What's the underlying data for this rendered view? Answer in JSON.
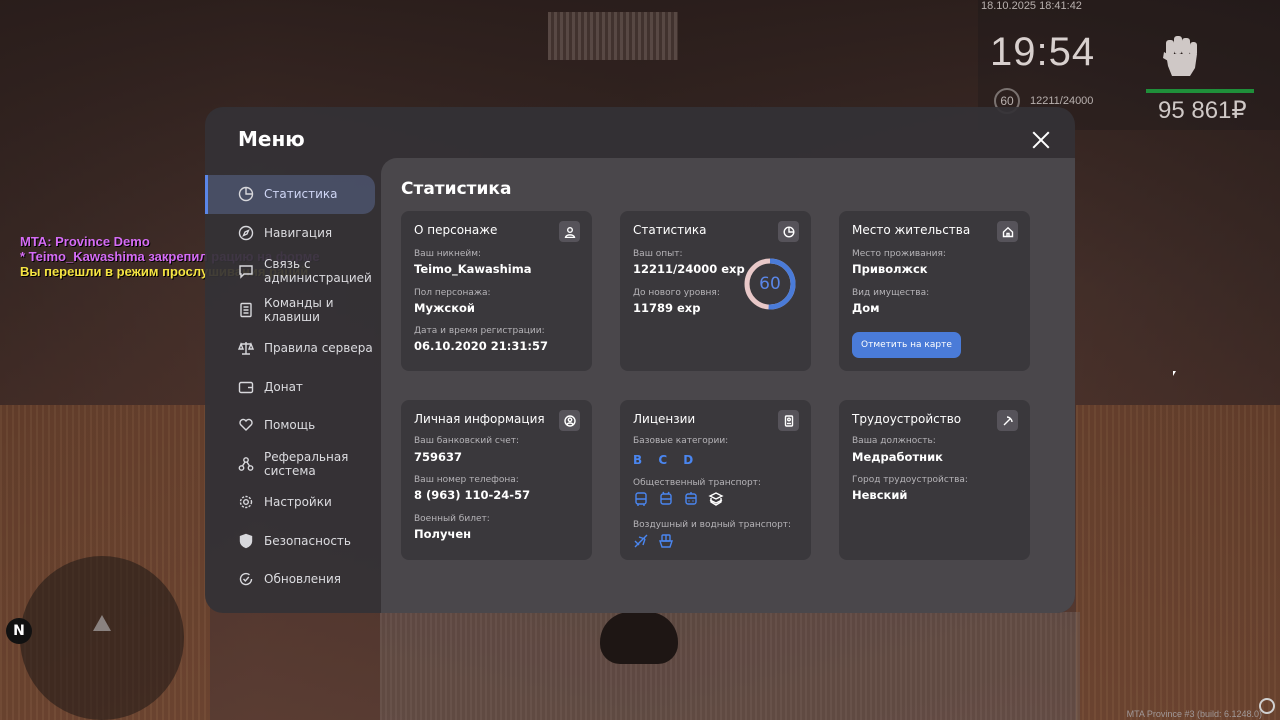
{
  "hud": {
    "datetime": "18.10.2025 18:41:42",
    "time": "19:54",
    "level": "60",
    "exp": "12211/24000",
    "money": "95 861₽",
    "health_fraction": 1.0,
    "build": "MTA Province #3 (build: 6.1248.0)"
  },
  "chat": {
    "line1": "MTA: Province Demo",
    "line2": "* Teimo_Kawashima закрепил рацию на форме",
    "line3": "Вы перешли в режим прослушивания раций."
  },
  "minimap": {
    "compass": "N"
  },
  "menu": {
    "title": "Меню",
    "sidebar": [
      {
        "label": "Статистика",
        "icon": "chart-pie-icon"
      },
      {
        "label": "Навигация",
        "icon": "compass-icon"
      },
      {
        "label": "Связь с администрацией",
        "icon": "chat-icon"
      },
      {
        "label": "Команды и клавиши",
        "icon": "document-icon"
      },
      {
        "label": "Правила сервера",
        "icon": "scales-icon"
      },
      {
        "label": "Донат",
        "icon": "wallet-icon"
      },
      {
        "label": "Помощь",
        "icon": "heart-hand-icon"
      },
      {
        "label": "Реферальная система",
        "icon": "referral-icon"
      },
      {
        "label": "Настройки",
        "icon": "gear-icon"
      },
      {
        "label": "Безопасность",
        "icon": "shield-icon"
      },
      {
        "label": "Обновления",
        "icon": "update-icon"
      }
    ],
    "content_title": "Статистика",
    "cards": {
      "character": {
        "title": "О персонаже",
        "nickname_label": "Ваш никнейм:",
        "nickname": "Teimo_Kawashima",
        "gender_label": "Пол персонажа:",
        "gender": "Мужской",
        "reg_label": "Дата и время регистрации:",
        "reg": "06.10.2020 21:31:57"
      },
      "stats": {
        "title": "Статистика",
        "exp_label": "Ваш опыт:",
        "exp": "12211/24000 exp",
        "next_label": "До нового уровня:",
        "next": "11789 exp",
        "level": "60",
        "progress": 0.509
      },
      "residence": {
        "title": "Место жительства",
        "place_label": "Место проживания:",
        "place": "Приволжск",
        "property_label": "Вид имущества:",
        "property": "Дом",
        "map_button": "Отметить на карте"
      },
      "personal": {
        "title": "Личная информация",
        "bank_label": "Ваш банковский счет:",
        "bank": "759637",
        "phone_label": "Ваш номер телефона:",
        "phone": "8 (963) 110-24-57",
        "military_label": "Военный билет:",
        "military": "Получен"
      },
      "licenses": {
        "title": "Лицензии",
        "base_label": "Базовые категории:",
        "categories": "B C D",
        "public_label": "Общественный транспорт:",
        "air_label": "Воздушный и водный транспорт:"
      },
      "job": {
        "title": "Трудоустройство",
        "position_label": "Ваша должность:",
        "position": "Медработник",
        "city_label": "Город трудоустройства:",
        "city": "Невский"
      }
    }
  },
  "colors": {
    "accent": "#4a7bd8",
    "progress_rest": "#e8c8c8",
    "health": "#1f8f3a"
  }
}
